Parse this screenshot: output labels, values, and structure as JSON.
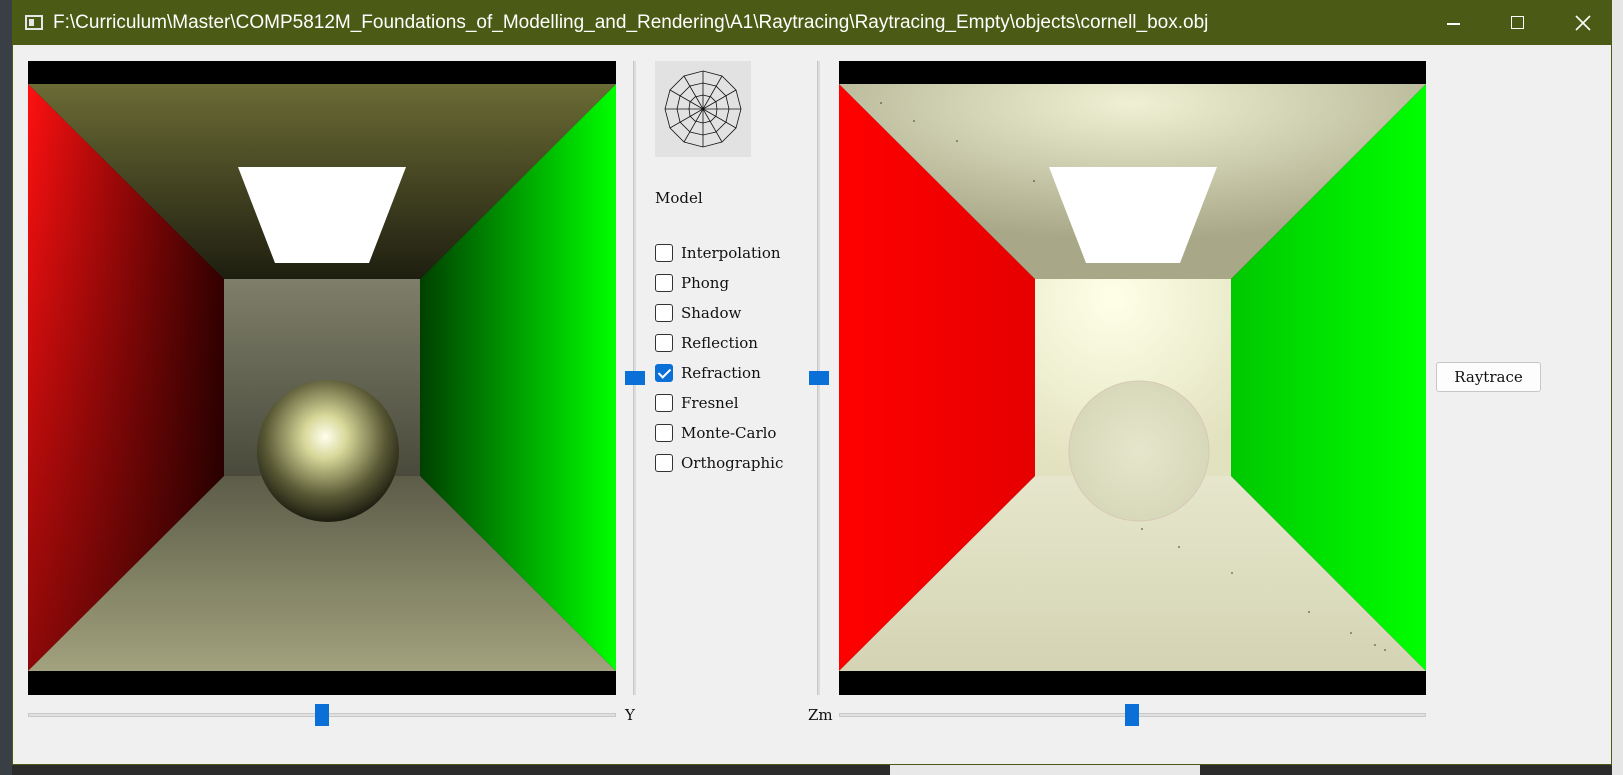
{
  "window": {
    "title": "F:\\Curriculum\\Master\\COMP5812M_Foundations_of_Modelling_and_Rendering\\A1\\Raytracing\\Raytracing_Empty\\objects\\cornell_box.obj",
    "accent_color": "#4b5a14"
  },
  "controls": {
    "model_label": "Model",
    "options": [
      {
        "label": "Interpolation",
        "checked": false
      },
      {
        "label": "Phong",
        "checked": false
      },
      {
        "label": "Shadow",
        "checked": false
      },
      {
        "label": "Reflection",
        "checked": false
      },
      {
        "label": "Refraction",
        "checked": true
      },
      {
        "label": "Fresnel",
        "checked": false
      },
      {
        "label": "Monte-Carlo",
        "checked": false
      },
      {
        "label": "Orthographic",
        "checked": false
      }
    ],
    "raytrace_label": "Raytrace"
  },
  "sliders": {
    "y_label": "Y",
    "zm_label": "Zm",
    "y_value": 0.5,
    "zm_value": 0.5
  },
  "icons": {
    "window_icon": "window-icon",
    "arcball": "arcball-sphere-icon",
    "minimize": "minimize-icon",
    "maximize": "maximize-icon",
    "close": "close-icon"
  },
  "colors": {
    "slider_accent": "#0a6fd6",
    "left_wall": "#ff0000",
    "right_wall": "#00ff00"
  }
}
